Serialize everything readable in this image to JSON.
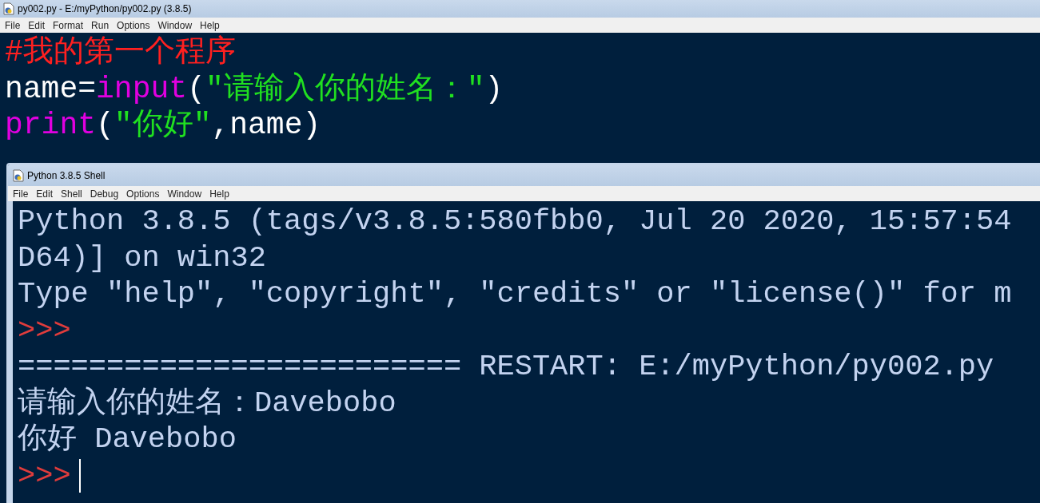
{
  "editor": {
    "title": "py002.py - E:/myPython/py002.py (3.8.5)",
    "menu": [
      "File",
      "Edit",
      "Format",
      "Run",
      "Options",
      "Window",
      "Help"
    ],
    "lines": [
      {
        "segments": [
          {
            "kind": "comment",
            "text": "#我的第一个程序"
          }
        ]
      },
      {
        "segments": [
          {
            "kind": "plain",
            "text": "name="
          },
          {
            "kind": "builtin",
            "text": "input"
          },
          {
            "kind": "plain",
            "text": "("
          },
          {
            "kind": "string",
            "text": "\"请输入你的姓名：\""
          },
          {
            "kind": "plain",
            "text": ")"
          }
        ]
      },
      {
        "segments": [
          {
            "kind": "builtin",
            "text": "print"
          },
          {
            "kind": "plain",
            "text": "("
          },
          {
            "kind": "string",
            "text": "\"你好\""
          },
          {
            "kind": "plain",
            "text": ",name)"
          }
        ]
      }
    ]
  },
  "shell": {
    "title": "Python 3.8.5 Shell",
    "menu": [
      "File",
      "Edit",
      "Shell",
      "Debug",
      "Options",
      "Window",
      "Help"
    ],
    "lines": [
      {
        "has_cursor": false,
        "segments": [
          {
            "kind": "output",
            "text": "Python 3.8.5 (tags/v3.8.5:580fbb0, Jul 20 2020, 15:57:54"
          }
        ]
      },
      {
        "has_cursor": false,
        "segments": [
          {
            "kind": "output",
            "text": "D64)] on win32"
          }
        ]
      },
      {
        "has_cursor": false,
        "segments": [
          {
            "kind": "output",
            "text": "Type \"help\", \"copyright\", \"credits\" or \"license()\" for m"
          }
        ]
      },
      {
        "has_cursor": false,
        "segments": [
          {
            "kind": "prompt",
            "text": ">>>"
          }
        ]
      },
      {
        "has_cursor": false,
        "segments": [
          {
            "kind": "output",
            "text": "========================= RESTART: E:/myPython/py002.py"
          }
        ]
      },
      {
        "has_cursor": false,
        "segments": [
          {
            "kind": "output",
            "text": "请输入你的姓名：Davebobo"
          }
        ]
      },
      {
        "has_cursor": false,
        "segments": [
          {
            "kind": "output",
            "text": "你好 Davebobo"
          }
        ]
      },
      {
        "has_cursor": true,
        "segments": [
          {
            "kind": "prompt",
            "text": ">>>"
          }
        ]
      }
    ]
  }
}
